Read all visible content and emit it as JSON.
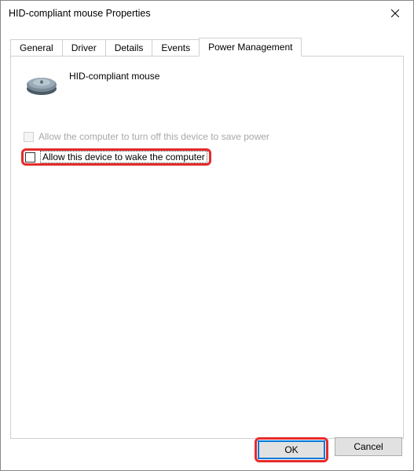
{
  "window": {
    "title": "HID-compliant mouse Properties"
  },
  "tabs": {
    "general": "General",
    "driver": "Driver",
    "details": "Details",
    "events": "Events",
    "power": "Power Management"
  },
  "panel": {
    "device_name": "HID-compliant mouse",
    "option_turnoff": "Allow the computer to turn off this device to save power",
    "option_wake": "Allow this device to wake the computer"
  },
  "buttons": {
    "ok": "OK",
    "cancel": "Cancel"
  }
}
